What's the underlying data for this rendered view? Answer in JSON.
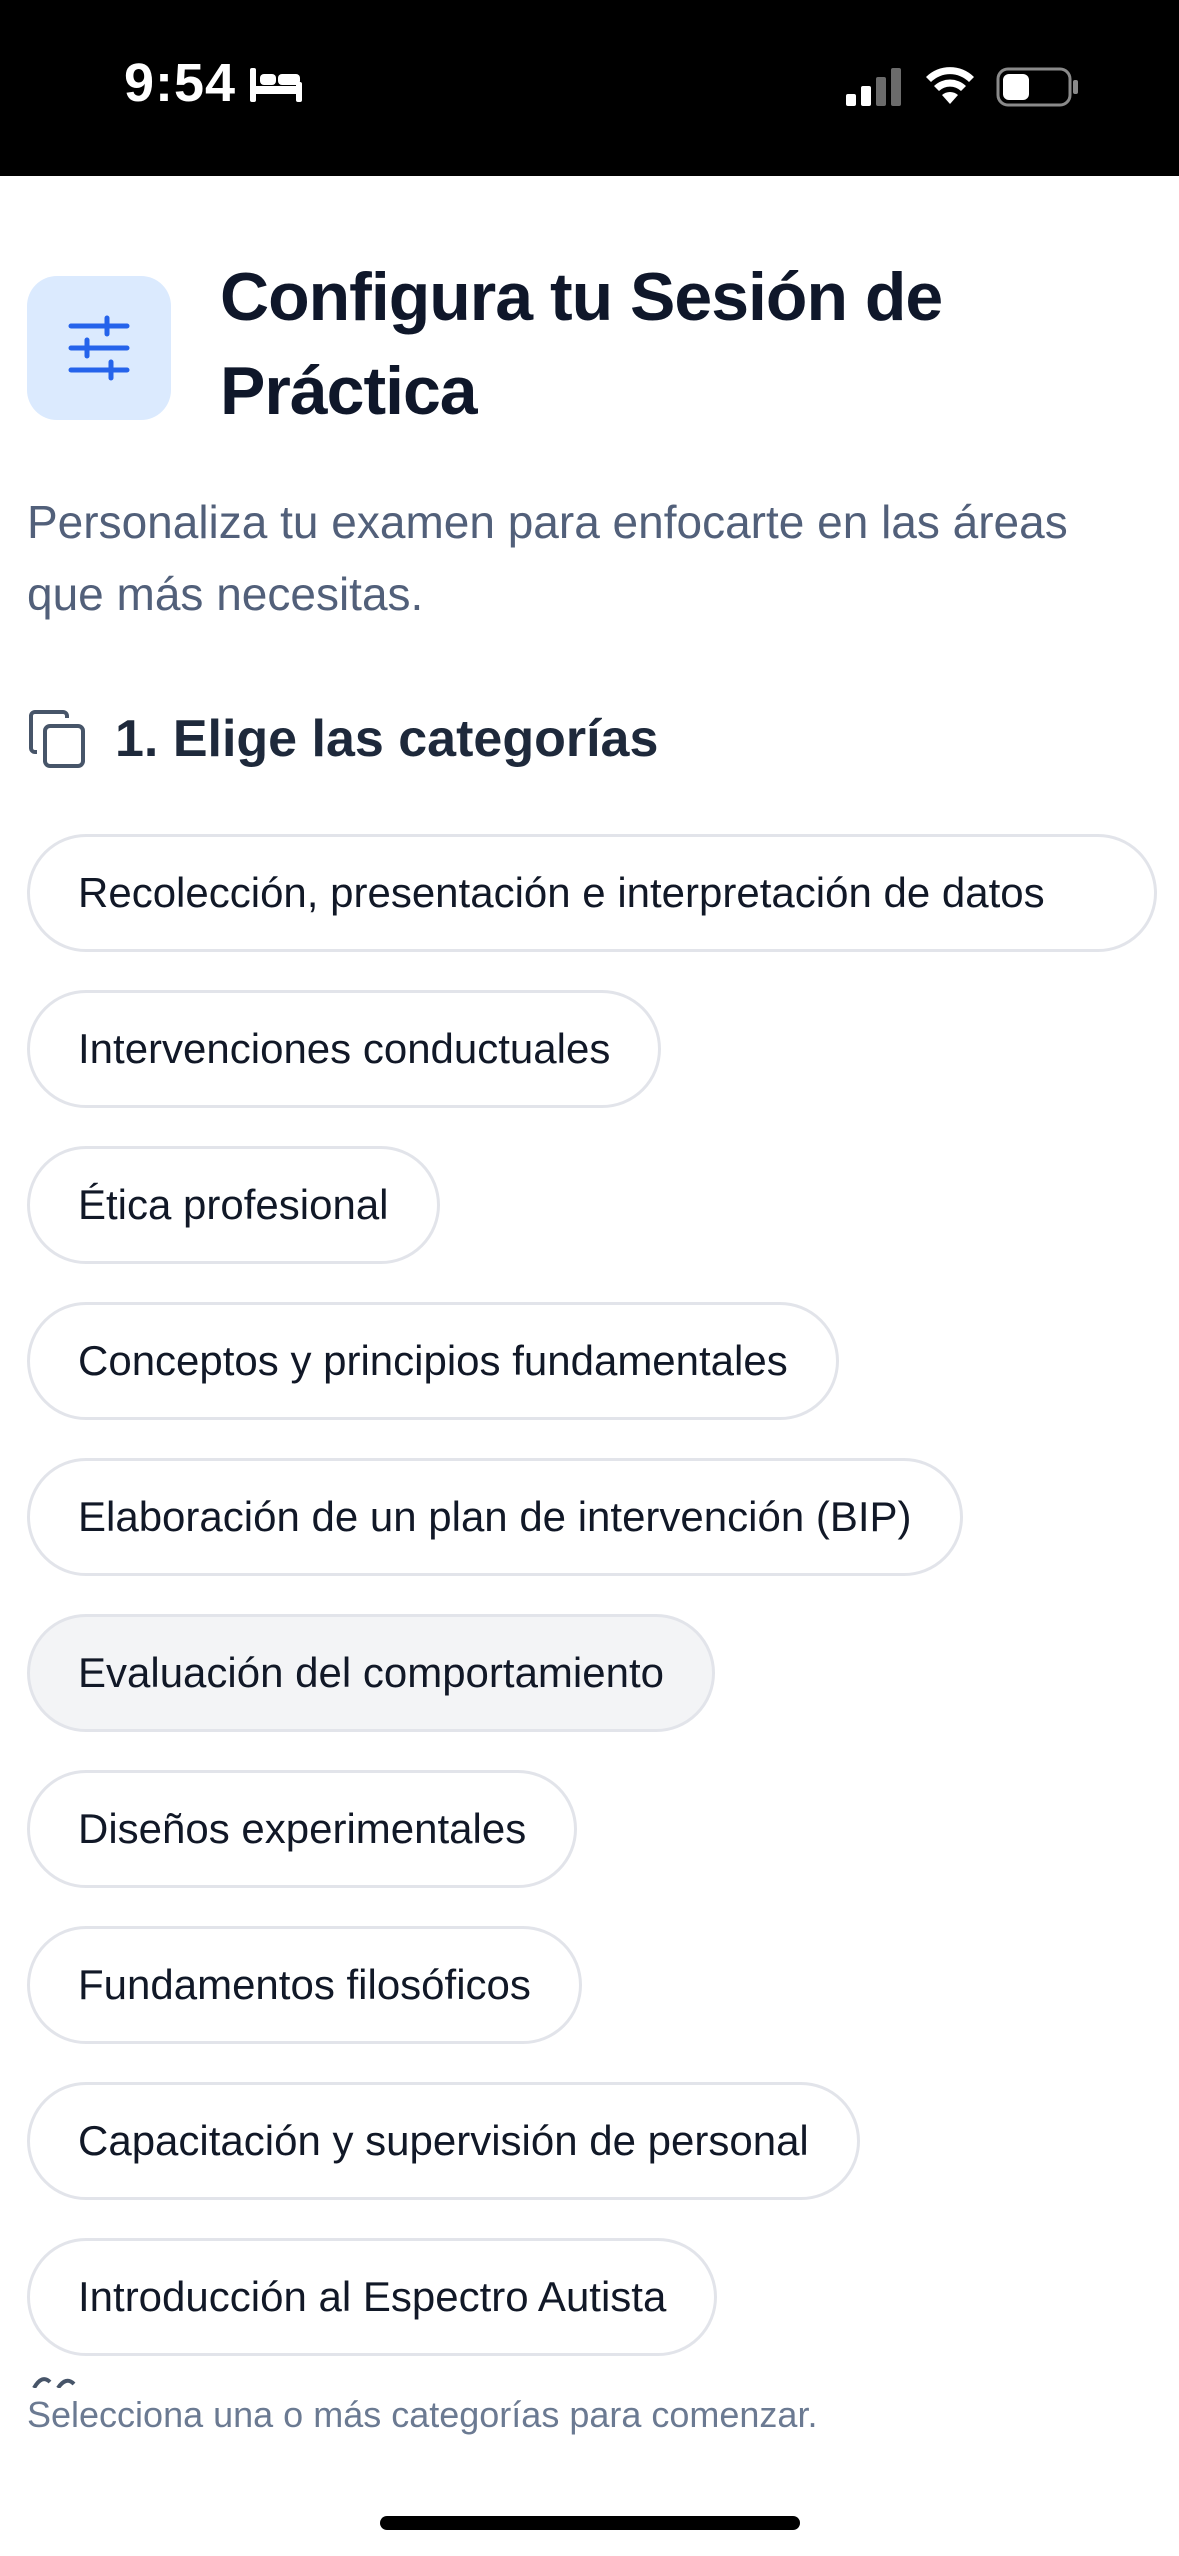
{
  "status_bar": {
    "time": "9:54"
  },
  "header": {
    "icon": "sliders-icon",
    "title": "Configura tu Sesión de Práctica",
    "subtitle": "Personaliza tu examen para enfocarte en las áreas que más necesitas."
  },
  "categories_section": {
    "icon": "copy-icon",
    "title": "1. Elige las categorías",
    "items": [
      {
        "label": "Recolección, presentación e interpretación de datos"
      },
      {
        "label": "Intervenciones conductuales"
      },
      {
        "label": "Ética profesional"
      },
      {
        "label": "Conceptos y principios fundamentales"
      },
      {
        "label": "Elaboración de un plan de intervención (BIP)"
      },
      {
        "label": "Evaluación del comportamiento"
      },
      {
        "label": "Diseños experimentales"
      },
      {
        "label": "Fundamentos filosóficos"
      },
      {
        "label": "Capacitación y supervisión de personal"
      },
      {
        "label": "Introducción al Espectro Autista"
      }
    ],
    "helper": "Selecciona una o más categorías para comenzar."
  },
  "colors": {
    "accent": "#2563eb",
    "accent_bg": "#dbeafe",
    "title": "#0f172a",
    "subtitle": "#52607a"
  }
}
